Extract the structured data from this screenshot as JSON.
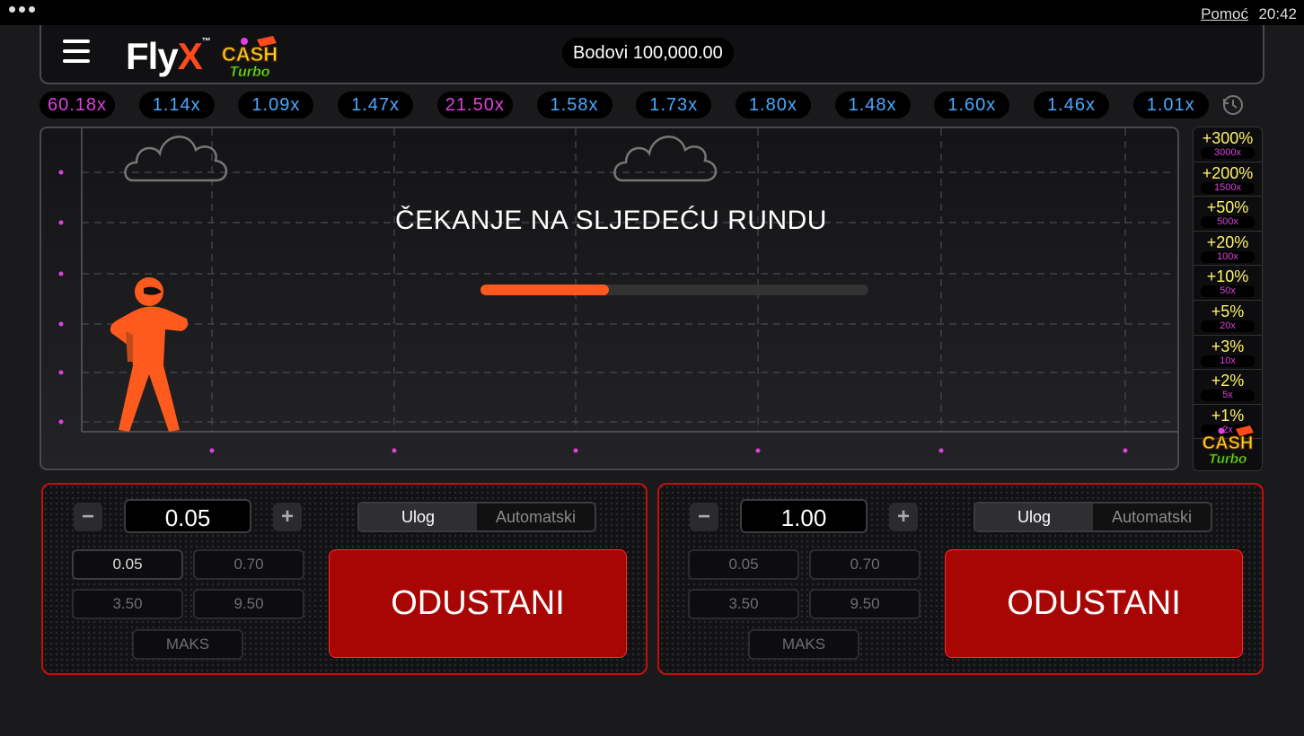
{
  "topbar": {
    "help": "Pomoć",
    "time": "20:42"
  },
  "header": {
    "logo_fly": "Fly",
    "logo_x": "X",
    "logo_tm": "™",
    "cash": "CASH",
    "turbo": "Turbo",
    "balance": "Bodovi 100,000.00"
  },
  "history": [
    {
      "value": "60.18x",
      "color": "#e040e0"
    },
    {
      "value": "1.14x",
      "color": "#4aa8ff"
    },
    {
      "value": "1.09x",
      "color": "#4aa8ff"
    },
    {
      "value": "1.47x",
      "color": "#4aa8ff"
    },
    {
      "value": "21.50x",
      "color": "#e040e0"
    },
    {
      "value": "1.58x",
      "color": "#4aa8ff"
    },
    {
      "value": "1.73x",
      "color": "#4aa8ff"
    },
    {
      "value": "1.80x",
      "color": "#4aa8ff"
    },
    {
      "value": "1.48x",
      "color": "#4aa8ff"
    },
    {
      "value": "1.60x",
      "color": "#4aa8ff"
    },
    {
      "value": "1.46x",
      "color": "#4aa8ff"
    },
    {
      "value": "1.01x",
      "color": "#4aa8ff"
    }
  ],
  "game": {
    "status": "ČEKANJE NA SLJEDEĆU RUNDU",
    "progress": 0.33
  },
  "tiers": [
    {
      "percent": "+300%",
      "mult": "3000x"
    },
    {
      "percent": "+200%",
      "mult": "1500x"
    },
    {
      "percent": "+50%",
      "mult": "500x"
    },
    {
      "percent": "+20%",
      "mult": "100x"
    },
    {
      "percent": "+10%",
      "mult": "50x"
    },
    {
      "percent": "+5%",
      "mult": "20x"
    },
    {
      "percent": "+3%",
      "mult": "10x"
    },
    {
      "percent": "+2%",
      "mult": "5x"
    },
    {
      "percent": "+1%",
      "mult": "2x"
    }
  ],
  "panels": [
    {
      "minus": "−",
      "plus": "+",
      "amount": "0.05",
      "tab_bet": "Ulog",
      "tab_auto": "Automatski",
      "quick": [
        "0.05",
        "0.70",
        "3.50",
        "9.50"
      ],
      "max": "MAKS",
      "action": "ODUSTANI",
      "selected_quick": 0
    },
    {
      "minus": "−",
      "plus": "+",
      "amount": "1.00",
      "tab_bet": "Ulog",
      "tab_auto": "Automatski",
      "quick": [
        "0.05",
        "0.70",
        "3.50",
        "9.50"
      ],
      "max": "MAKS",
      "action": "ODUSTANI",
      "selected_quick": -1
    }
  ],
  "colors": {
    "accent": "#ff5a1e",
    "danger": "#a80505",
    "panel_border": "#c50f0f",
    "tier_text": "#fff36a",
    "magenta": "#e040e0",
    "blue": "#4aa8ff"
  }
}
